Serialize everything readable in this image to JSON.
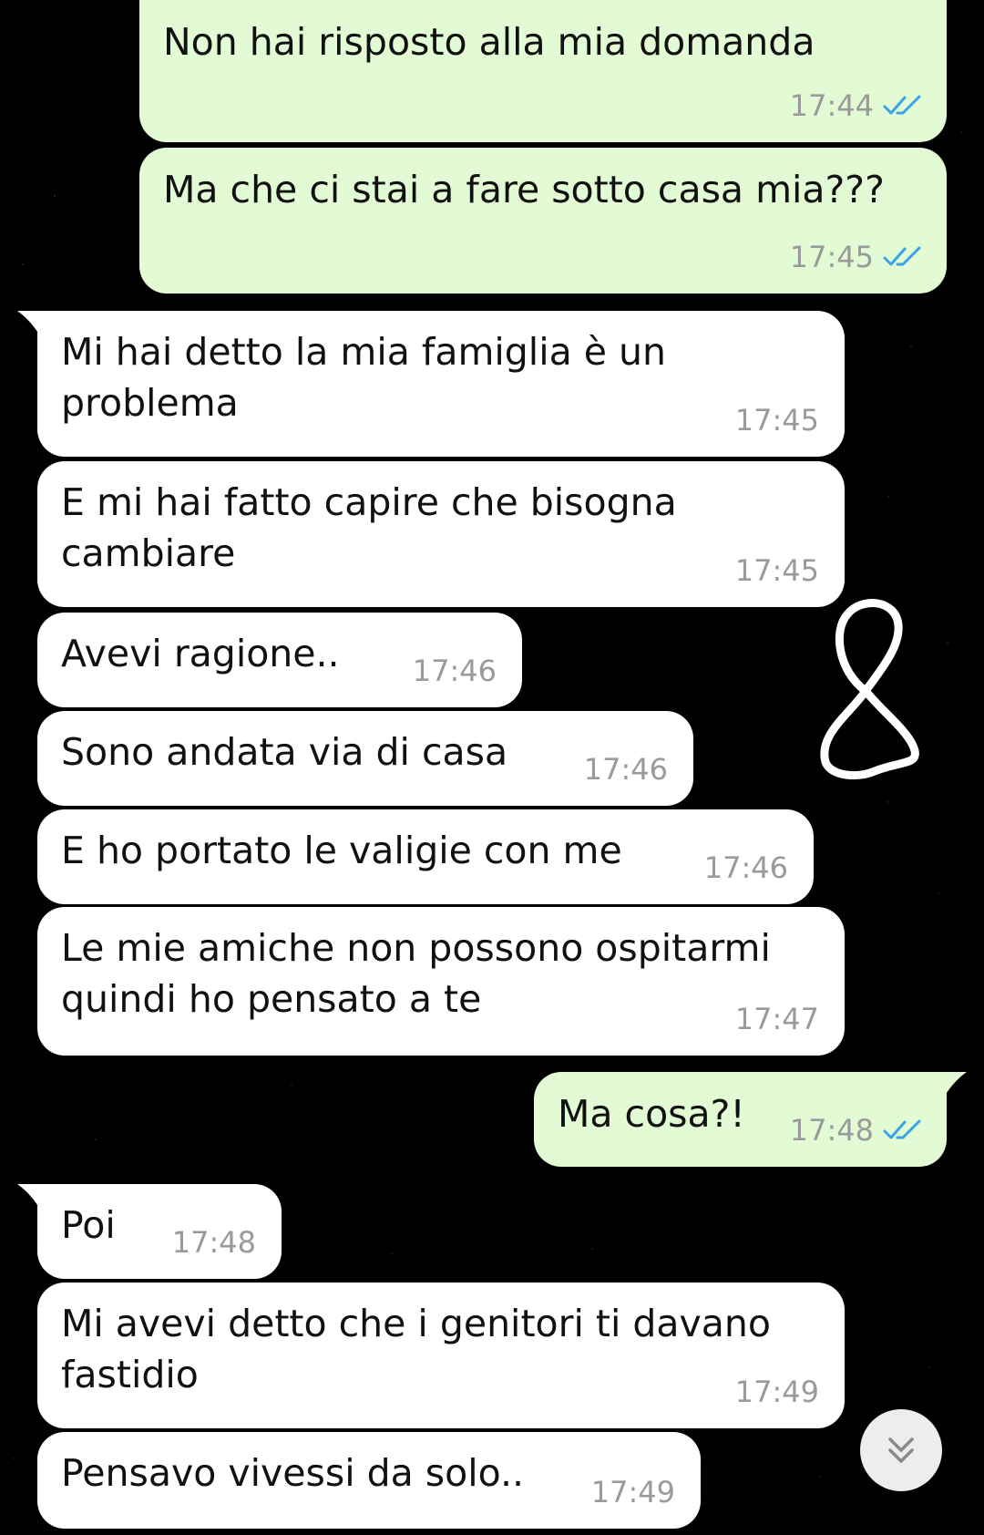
{
  "messages": [
    {
      "direction": "out",
      "text": "Non hai risposto alla mia domanda",
      "time": "17:44",
      "status_icon": "double-check-read-icon"
    },
    {
      "direction": "out",
      "text": "Ma che ci stai a fare sotto casa mia???",
      "time": "17:45",
      "status_icon": "double-check-read-icon"
    },
    {
      "direction": "in",
      "text": "Mi hai detto la mia famiglia è un\nproblema",
      "time": "17:45"
    },
    {
      "direction": "in",
      "text": "E mi hai fatto capire che bisogna\ncambiare",
      "time": "17:45"
    },
    {
      "direction": "in",
      "text": "Avevi ragione..",
      "time": "17:46"
    },
    {
      "direction": "in",
      "text": "Sono andata via di casa",
      "time": "17:46"
    },
    {
      "direction": "in",
      "text": "E ho portato le valigie con me",
      "time": "17:46"
    },
    {
      "direction": "in",
      "text": "Le mie amiche non possono ospitarmi\nquindi ho pensato a te",
      "time": "17:47"
    },
    {
      "direction": "out",
      "text": "Ma cosa?!",
      "time": "17:48",
      "status_icon": "double-check-read-icon"
    },
    {
      "direction": "in",
      "text": "Poi",
      "time": "17:48"
    },
    {
      "direction": "in",
      "text": "Mi avevi detto che i genitori ti davano\nfastidio",
      "time": "17:49"
    },
    {
      "direction": "in",
      "text": "Pensavo vivessi da solo..",
      "time": "17:49"
    }
  ],
  "overlay": {
    "drawing_icon": "handwritten-8-doodle-icon"
  },
  "scroll_button": {
    "icon": "double-chevron-down-icon"
  },
  "colors": {
    "background": "#000000",
    "outgoing_bubble": "#e2fbd5",
    "incoming_bubble": "#ffffff",
    "timestamp": "#9a9a9a",
    "read_ticks": "#3aa3e8"
  }
}
